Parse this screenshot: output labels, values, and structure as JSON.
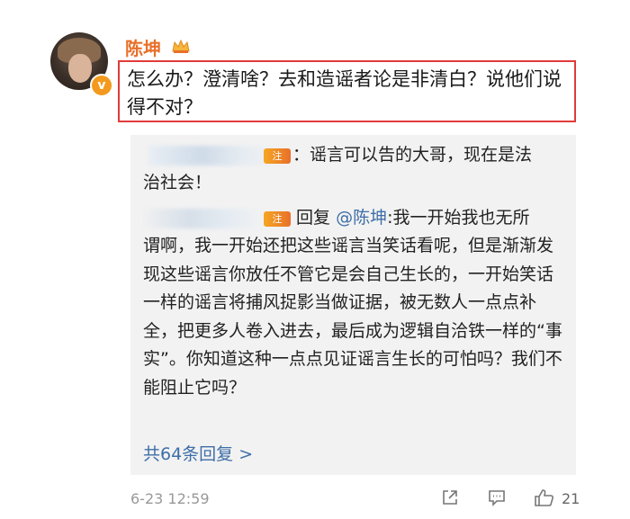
{
  "post": {
    "author": "陈坤",
    "text": "怎么办？澄清啥？去和造谣者论是非清白？说他们说得不对？",
    "timestamp": "6-23 12:59",
    "like_count": "21"
  },
  "replies": {
    "first": {
      "badge": "注",
      "line1": "：谣言可以告的大哥，现在是法",
      "line2": "治社会！"
    },
    "second": {
      "badge": "注",
      "prefix": "回复",
      "mention": "@陈坤",
      "first_line_rest": ":我一开始我也无所",
      "body": "谓啊，我一开始还把这些谣言当笑话看呢，但是渐渐发现这些谣言你放任不管它是会自己生长的，一开始笑话一样的谣言将捕风捉影当做证据，被无数人一点点补全，把更多人卷入进去，最后成为逻辑自洽铁一样的“事实”。你知道这种一点点见证谣言生长的可怕吗？我们不能阻止它吗？"
    },
    "more_label": "共64条回复 >"
  },
  "colors": {
    "author": "#e8702a",
    "highlight_border": "#e23a3a",
    "link": "#3e6ea8",
    "reply_bg": "#f2f2f2"
  }
}
